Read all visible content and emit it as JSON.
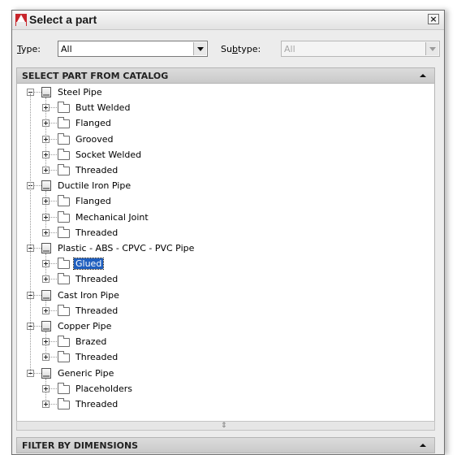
{
  "window": {
    "title": "Select a part",
    "close_label": "×"
  },
  "type_field": {
    "label_prefix": "T",
    "label_rest": "ype:",
    "value": "All"
  },
  "subtype_field": {
    "label_pre": "Su",
    "label_u": "b",
    "label_rest": "type:",
    "value": "All"
  },
  "catalog_header": "SELECT PART FROM CATALOG",
  "filter_header": "FILTER BY DIMENSIONS",
  "tree": [
    {
      "label": "Steel Pipe",
      "children": [
        "Butt Welded",
        "Flanged",
        "Grooved",
        "Socket Welded",
        "Threaded"
      ]
    },
    {
      "label": "Ductile Iron Pipe",
      "children": [
        "Flanged",
        "Mechanical Joint",
        "Threaded"
      ]
    },
    {
      "label": "Plastic - ABS - CPVC - PVC Pipe",
      "children": [
        "Glued",
        "Threaded"
      ]
    },
    {
      "label": "Cast Iron Pipe",
      "children": [
        "Threaded"
      ]
    },
    {
      "label": "Copper Pipe",
      "children": [
        "Brazed",
        "Threaded"
      ]
    },
    {
      "label": "Generic Pipe",
      "children": [
        "Placeholders",
        "Threaded"
      ]
    }
  ],
  "selected": {
    "group": 2,
    "child": 0
  },
  "colors": {
    "selection": "#1f5fbf",
    "header_bg": "#d4d4d4",
    "app_icon": "#c8262c"
  }
}
